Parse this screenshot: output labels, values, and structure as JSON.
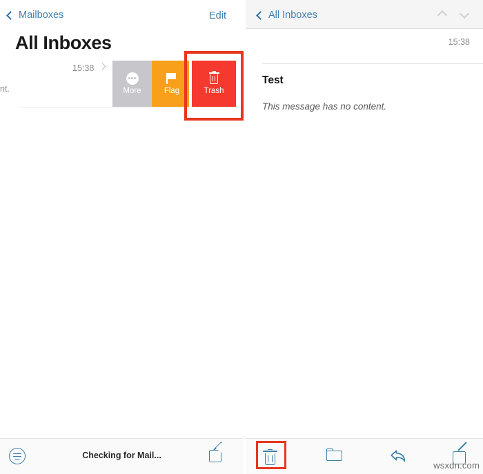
{
  "colors": {
    "accent_blue": "#3b7fa8",
    "link_blue": "#3c7fb1",
    "trash_red": "#f5392e",
    "flag_orange": "#f8a01b",
    "more_gray": "#c6c6cb",
    "annotation_red": "#e8361f",
    "navbar_gray": "#f5f5f5",
    "toolbar_gray": "#fafafa"
  },
  "mail_list_panel": {
    "navbar": {
      "back_label": "Mailboxes",
      "back_icon": "chevron-left-icon",
      "edit_label": "Edit"
    },
    "title": "All Inboxes",
    "row": {
      "snippet_fragment": "nt.",
      "time": "15:38",
      "disclosure_icon": "chevron-right-icon"
    },
    "swipe_actions": [
      {
        "label": "More",
        "icon": "ellipsis-circle-icon",
        "color": "#c6c6cb"
      },
      {
        "label": "Flag",
        "icon": "flag-icon",
        "color": "#f8a01b"
      },
      {
        "label": "Trash",
        "icon": "trash-icon",
        "color": "#f5392e"
      }
    ],
    "toolbar": {
      "filter_icon": "filter-circle-icon",
      "status_text": "Checking for Mail...",
      "compose_icon": "compose-icon"
    }
  },
  "message_panel": {
    "navbar": {
      "back_label": "All Inboxes",
      "back_icon": "chevron-left-icon",
      "prev_icon": "chevron-up-icon",
      "next_icon": "chevron-down-icon"
    },
    "message": {
      "time": "15:38",
      "subject": "Test",
      "body": "This message has no content."
    },
    "toolbar": {
      "trash_icon": "trash-icon",
      "folder_icon": "folder-icon",
      "reply_icon": "reply-arrow-icon",
      "compose_icon": "compose-icon"
    }
  },
  "annotations": {
    "trash_swipe_highlight": "red-rectangle-highlight",
    "trash_toolbar_highlight": "red-rectangle-highlight"
  },
  "watermark": "wsxdn.com"
}
